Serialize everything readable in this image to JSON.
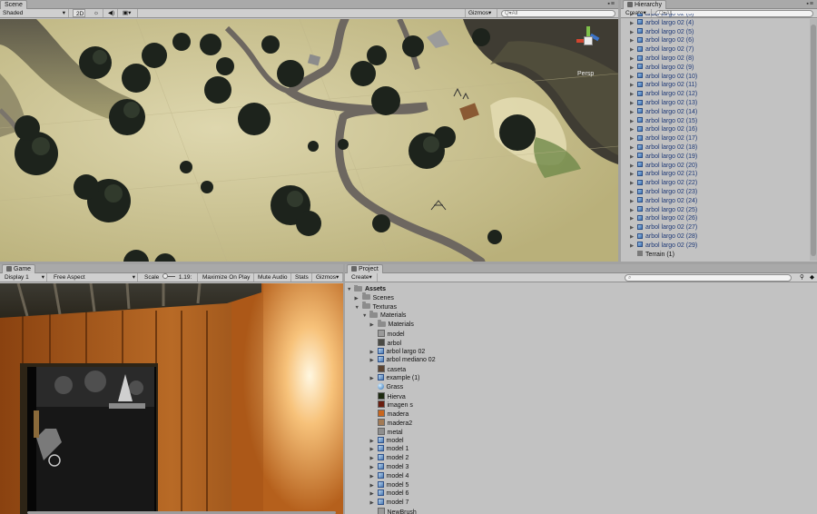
{
  "scene": {
    "tab": "Scene",
    "shading": "Shaded",
    "mode_2d": "2D",
    "gizmos": "Gizmos",
    "search_placeholder": "Q▾All",
    "persp_label": "Persp"
  },
  "hierarchy": {
    "tab": "Hierarchy",
    "create": "Create",
    "search_placeholder": "Q▾All",
    "items": [
      "arbol largo 02 (3)",
      "arbol largo 02 (4)",
      "arbol largo 02 (5)",
      "arbol largo 02 (6)",
      "arbol largo 02 (7)",
      "arbol largo 02 (8)",
      "arbol largo 02 (9)",
      "arbol largo 02 (10)",
      "arbol largo 02 (11)",
      "arbol largo 02 (12)",
      "arbol largo 02 (13)",
      "arbol largo 02 (14)",
      "arbol largo 02 (15)",
      "arbol largo 02 (16)",
      "arbol largo 02 (17)",
      "arbol largo 02 (18)",
      "arbol largo 02 (19)",
      "arbol largo 02 (20)",
      "arbol largo 02 (21)",
      "arbol largo 02 (22)",
      "arbol largo 02 (23)",
      "arbol largo 02 (24)",
      "arbol largo 02 (25)",
      "arbol largo 02 (26)",
      "arbol largo 02 (27)",
      "arbol largo 02 (28)",
      "arbol largo 02 (29)"
    ],
    "terrain": "Terrain (1)"
  },
  "game": {
    "tab": "Game",
    "display": "Display 1",
    "aspect": "Free Aspect",
    "scale_label": "Scale",
    "scale_value": "1.19:",
    "maximize": "Maximize On Play",
    "mute": "Mute Audio",
    "stats": "Stats",
    "gizmos": "Gizmos"
  },
  "project": {
    "tab": "Project",
    "create": "Create",
    "items": [
      {
        "label": "Assets",
        "indent": 0,
        "arrow": "▼",
        "icon": "folder",
        "bold": true
      },
      {
        "label": "Scenes",
        "indent": 1,
        "arrow": "▶",
        "icon": "folder"
      },
      {
        "label": "Texturas",
        "indent": 1,
        "arrow": "▼",
        "icon": "folder"
      },
      {
        "label": "Materials",
        "indent": 2,
        "arrow": "▼",
        "icon": "folder"
      },
      {
        "label": "Materials",
        "indent": 3,
        "arrow": "▶",
        "icon": "folder"
      },
      {
        "label": "model",
        "indent": 3,
        "arrow": "",
        "icon": "gray"
      },
      {
        "label": "arbol",
        "indent": 3,
        "arrow": "",
        "icon": "tex-dark"
      },
      {
        "label": "arbol largo 02",
        "indent": 3,
        "arrow": "▶",
        "icon": "cube"
      },
      {
        "label": "arbol mediano 02",
        "indent": 3,
        "arrow": "▶",
        "icon": "cube"
      },
      {
        "label": "caseta",
        "indent": 3,
        "arrow": "",
        "icon": "tex-brown"
      },
      {
        "label": "example (1)",
        "indent": 3,
        "arrow": "▶",
        "icon": "cube"
      },
      {
        "label": "Grass",
        "indent": 3,
        "arrow": "",
        "icon": "ball"
      },
      {
        "label": "Hierva",
        "indent": 3,
        "arrow": "",
        "icon": "tex-green"
      },
      {
        "label": "imagen s",
        "indent": 3,
        "arrow": "",
        "icon": "tex-red"
      },
      {
        "label": "madera",
        "indent": 3,
        "arrow": "",
        "icon": "tex-orange"
      },
      {
        "label": "madera2",
        "indent": 3,
        "arrow": "",
        "icon": "tex-tan"
      },
      {
        "label": "metal",
        "indent": 3,
        "arrow": "",
        "icon": "tex-gray"
      },
      {
        "label": "model",
        "indent": 3,
        "arrow": "▶",
        "icon": "cube"
      },
      {
        "label": "model 1",
        "indent": 3,
        "arrow": "▶",
        "icon": "cube"
      },
      {
        "label": "model 2",
        "indent": 3,
        "arrow": "▶",
        "icon": "cube"
      },
      {
        "label": "model 3",
        "indent": 3,
        "arrow": "▶",
        "icon": "cube"
      },
      {
        "label": "model 4",
        "indent": 3,
        "arrow": "▶",
        "icon": "cube"
      },
      {
        "label": "model 5",
        "indent": 3,
        "arrow": "▶",
        "icon": "cube"
      },
      {
        "label": "model 6",
        "indent": 3,
        "arrow": "▶",
        "icon": "cube"
      },
      {
        "label": "model 7",
        "indent": 3,
        "arrow": "▶",
        "icon": "cube"
      },
      {
        "label": "NewBrush",
        "indent": 3,
        "arrow": "",
        "icon": "gray"
      }
    ]
  },
  "colors": {
    "editor_bg": "#c2c2c2",
    "terrain": "#cfc79a",
    "selection_blue": "#1f3a78"
  }
}
